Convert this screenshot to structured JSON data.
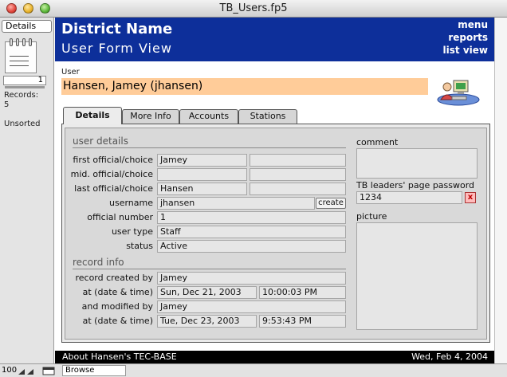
{
  "window": {
    "title": "TB_Users.fp5"
  },
  "left_pane": {
    "layout": "Details",
    "record_counter": "1",
    "records_label": "Records:",
    "records_count": "5",
    "sort_status": "Unsorted"
  },
  "header": {
    "district": "District Name",
    "subtitle": "User Form View",
    "links": [
      "menu",
      "reports",
      "list view"
    ]
  },
  "user": {
    "caption": "User",
    "name": "Hansen, Jamey (jhansen)"
  },
  "tabs": [
    "Details",
    "More Info",
    "Accounts",
    "Stations"
  ],
  "user_details": {
    "title": "user details",
    "first_label": "first official/choice",
    "first_official": "Jamey",
    "first_choice": "",
    "mid_label": "mid. official/choice",
    "mid_official": "",
    "mid_choice": "",
    "last_label": "last official/choice",
    "last_official": "Hansen",
    "last_choice": "",
    "username_label": "username",
    "username": "jhansen",
    "create_button": "create",
    "official_number_label": "official number",
    "official_number": "1",
    "user_type_label": "user type",
    "user_type": "Staff",
    "status_label": "status",
    "status": "Active"
  },
  "record_info": {
    "title": "record info",
    "created_by_label": "record created by",
    "created_by": "Jamey",
    "created_at_label": "at (date & time)",
    "created_date": "Sun, Dec 21, 2003",
    "created_time": "10:00:03 PM",
    "modified_by_label": "and modified by",
    "modified_by": "Jamey",
    "modified_at_label": "at (date & time)",
    "modified_date": "Tue, Dec 23, 2003",
    "modified_time": "9:53:43 PM"
  },
  "right_col": {
    "comment_label": "comment",
    "comment": "",
    "password_label": "TB leaders' page password",
    "password": "1234",
    "clear_button": "x",
    "picture_label": "picture"
  },
  "footer": {
    "about": "About Hansen's TEC-BASE",
    "date": "Wed, Feb 4, 2004"
  },
  "statusbar": {
    "zoom": "100",
    "mode": "Browse"
  }
}
